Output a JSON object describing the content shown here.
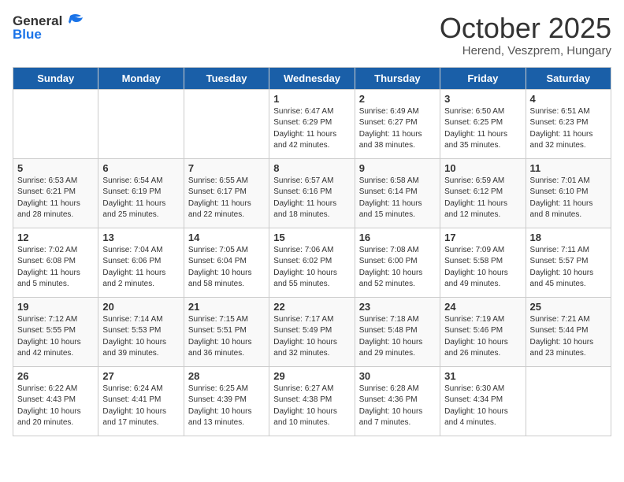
{
  "header": {
    "logo_general": "General",
    "logo_blue": "Blue",
    "month": "October 2025",
    "location": "Herend, Veszprem, Hungary"
  },
  "days_of_week": [
    "Sunday",
    "Monday",
    "Tuesday",
    "Wednesday",
    "Thursday",
    "Friday",
    "Saturday"
  ],
  "weeks": [
    [
      {
        "day": "",
        "text": ""
      },
      {
        "day": "",
        "text": ""
      },
      {
        "day": "",
        "text": ""
      },
      {
        "day": "1",
        "text": "Sunrise: 6:47 AM\nSunset: 6:29 PM\nDaylight: 11 hours\nand 42 minutes."
      },
      {
        "day": "2",
        "text": "Sunrise: 6:49 AM\nSunset: 6:27 PM\nDaylight: 11 hours\nand 38 minutes."
      },
      {
        "day": "3",
        "text": "Sunrise: 6:50 AM\nSunset: 6:25 PM\nDaylight: 11 hours\nand 35 minutes."
      },
      {
        "day": "4",
        "text": "Sunrise: 6:51 AM\nSunset: 6:23 PM\nDaylight: 11 hours\nand 32 minutes."
      }
    ],
    [
      {
        "day": "5",
        "text": "Sunrise: 6:53 AM\nSunset: 6:21 PM\nDaylight: 11 hours\nand 28 minutes."
      },
      {
        "day": "6",
        "text": "Sunrise: 6:54 AM\nSunset: 6:19 PM\nDaylight: 11 hours\nand 25 minutes."
      },
      {
        "day": "7",
        "text": "Sunrise: 6:55 AM\nSunset: 6:17 PM\nDaylight: 11 hours\nand 22 minutes."
      },
      {
        "day": "8",
        "text": "Sunrise: 6:57 AM\nSunset: 6:16 PM\nDaylight: 11 hours\nand 18 minutes."
      },
      {
        "day": "9",
        "text": "Sunrise: 6:58 AM\nSunset: 6:14 PM\nDaylight: 11 hours\nand 15 minutes."
      },
      {
        "day": "10",
        "text": "Sunrise: 6:59 AM\nSunset: 6:12 PM\nDaylight: 11 hours\nand 12 minutes."
      },
      {
        "day": "11",
        "text": "Sunrise: 7:01 AM\nSunset: 6:10 PM\nDaylight: 11 hours\nand 8 minutes."
      }
    ],
    [
      {
        "day": "12",
        "text": "Sunrise: 7:02 AM\nSunset: 6:08 PM\nDaylight: 11 hours\nand 5 minutes."
      },
      {
        "day": "13",
        "text": "Sunrise: 7:04 AM\nSunset: 6:06 PM\nDaylight: 11 hours\nand 2 minutes."
      },
      {
        "day": "14",
        "text": "Sunrise: 7:05 AM\nSunset: 6:04 PM\nDaylight: 10 hours\nand 58 minutes."
      },
      {
        "day": "15",
        "text": "Sunrise: 7:06 AM\nSunset: 6:02 PM\nDaylight: 10 hours\nand 55 minutes."
      },
      {
        "day": "16",
        "text": "Sunrise: 7:08 AM\nSunset: 6:00 PM\nDaylight: 10 hours\nand 52 minutes."
      },
      {
        "day": "17",
        "text": "Sunrise: 7:09 AM\nSunset: 5:58 PM\nDaylight: 10 hours\nand 49 minutes."
      },
      {
        "day": "18",
        "text": "Sunrise: 7:11 AM\nSunset: 5:57 PM\nDaylight: 10 hours\nand 45 minutes."
      }
    ],
    [
      {
        "day": "19",
        "text": "Sunrise: 7:12 AM\nSunset: 5:55 PM\nDaylight: 10 hours\nand 42 minutes."
      },
      {
        "day": "20",
        "text": "Sunrise: 7:14 AM\nSunset: 5:53 PM\nDaylight: 10 hours\nand 39 minutes."
      },
      {
        "day": "21",
        "text": "Sunrise: 7:15 AM\nSunset: 5:51 PM\nDaylight: 10 hours\nand 36 minutes."
      },
      {
        "day": "22",
        "text": "Sunrise: 7:17 AM\nSunset: 5:49 PM\nDaylight: 10 hours\nand 32 minutes."
      },
      {
        "day": "23",
        "text": "Sunrise: 7:18 AM\nSunset: 5:48 PM\nDaylight: 10 hours\nand 29 minutes."
      },
      {
        "day": "24",
        "text": "Sunrise: 7:19 AM\nSunset: 5:46 PM\nDaylight: 10 hours\nand 26 minutes."
      },
      {
        "day": "25",
        "text": "Sunrise: 7:21 AM\nSunset: 5:44 PM\nDaylight: 10 hours\nand 23 minutes."
      }
    ],
    [
      {
        "day": "26",
        "text": "Sunrise: 6:22 AM\nSunset: 4:43 PM\nDaylight: 10 hours\nand 20 minutes."
      },
      {
        "day": "27",
        "text": "Sunrise: 6:24 AM\nSunset: 4:41 PM\nDaylight: 10 hours\nand 17 minutes."
      },
      {
        "day": "28",
        "text": "Sunrise: 6:25 AM\nSunset: 4:39 PM\nDaylight: 10 hours\nand 13 minutes."
      },
      {
        "day": "29",
        "text": "Sunrise: 6:27 AM\nSunset: 4:38 PM\nDaylight: 10 hours\nand 10 minutes."
      },
      {
        "day": "30",
        "text": "Sunrise: 6:28 AM\nSunset: 4:36 PM\nDaylight: 10 hours\nand 7 minutes."
      },
      {
        "day": "31",
        "text": "Sunrise: 6:30 AM\nSunset: 4:34 PM\nDaylight: 10 hours\nand 4 minutes."
      },
      {
        "day": "",
        "text": ""
      }
    ]
  ]
}
